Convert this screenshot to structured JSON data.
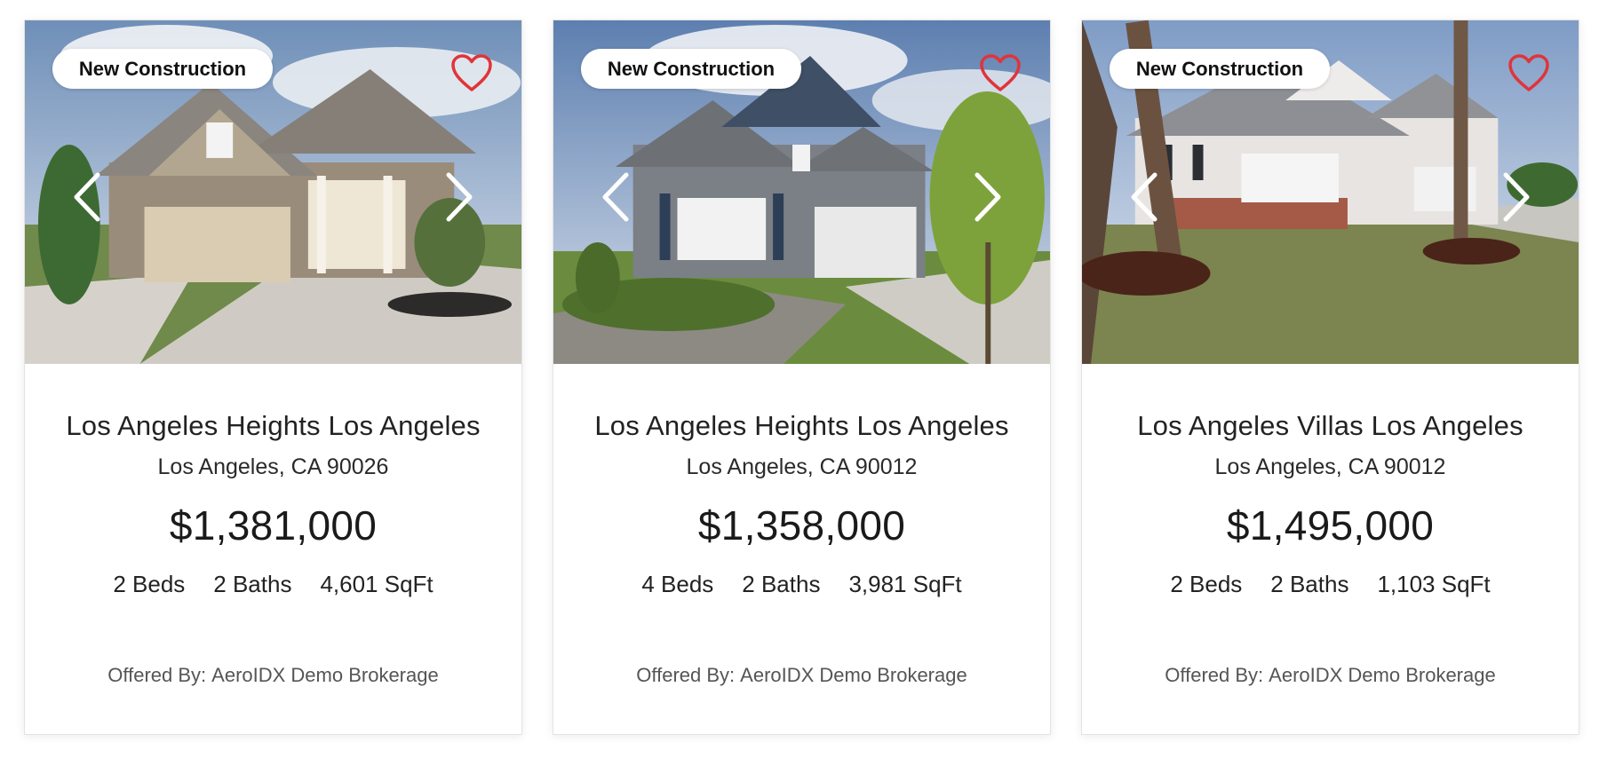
{
  "colors": {
    "heart": "#e0343a",
    "arrow": "#ffffff",
    "badge_bg": "#ffffff"
  },
  "icons": {
    "favorite": "heart-outline-icon",
    "prev": "chevron-left-icon",
    "next": "chevron-right-icon"
  },
  "listings": [
    {
      "badge": "New Construction",
      "title": "Los Angeles Heights Los Angeles",
      "city_line": "Los Angeles, CA 90026",
      "price": "$1,381,000",
      "beds": "2 Beds",
      "baths": "2 Baths",
      "sqft": "4,601 SqFt",
      "offered_prefix": "Offered By:",
      "brokerage": "AeroIDX Demo Brokerage"
    },
    {
      "badge": "New Construction",
      "title": "Los Angeles Heights Los Angeles",
      "city_line": "Los Angeles, CA 90012",
      "price": "$1,358,000",
      "beds": "4 Beds",
      "baths": "2 Baths",
      "sqft": "3,981 SqFt",
      "offered_prefix": "Offered By:",
      "brokerage": "AeroIDX Demo Brokerage"
    },
    {
      "badge": "New Construction",
      "title": "Los Angeles Villas Los Angeles",
      "city_line": "Los Angeles, CA 90012",
      "price": "$1,495,000",
      "beds": "2 Beds",
      "baths": "2 Baths",
      "sqft": "1,103 SqFt",
      "offered_prefix": "Offered By:",
      "brokerage": "AeroIDX Demo Brokerage"
    }
  ]
}
